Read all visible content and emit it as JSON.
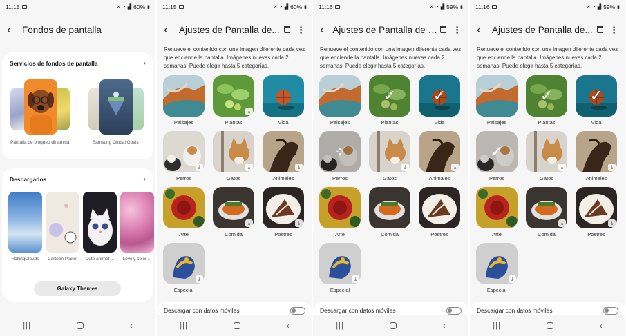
{
  "screen1": {
    "status": {
      "time": "11:15",
      "battery": "60%"
    },
    "header": {
      "title": "Fondos de pantalla"
    },
    "services": {
      "title": "Servicios de fondos de pantalla",
      "items": [
        {
          "label": "Pantalla de bloqueo dinámica"
        },
        {
          "label": "Samsung Global Goals"
        }
      ]
    },
    "downloaded": {
      "title": "Descargados",
      "items": [
        {
          "label": "RollingClouds"
        },
        {
          "label": "Cartoon Planet"
        },
        {
          "label": "Cute animal ..."
        },
        {
          "label": "Lovely color ..."
        }
      ]
    },
    "galaxy_themes": "Galaxy Themes"
  },
  "settings_screens": [
    {
      "status": {
        "time": "11:15",
        "battery": "60%"
      },
      "title": "Ajustes de Pantalla de...",
      "selected": [],
      "loading": [],
      "downloaded": [
        "Plantas",
        "Perros",
        "Gatos",
        "Animales",
        "Comida",
        "Postres",
        "Especial"
      ]
    },
    {
      "status": {
        "time": "11:16",
        "battery": "59%"
      },
      "title": "Ajustes de Pantalla de bloqueo",
      "selected": [
        "Plantas",
        "Vida"
      ],
      "loading": [
        "Perros"
      ],
      "downloaded": [
        "Gatos",
        "Animales",
        "Especial"
      ]
    },
    {
      "status": {
        "time": "11:16",
        "battery": "59%"
      },
      "title": "Ajustes de Pantalla de...",
      "selected": [
        "Plantas",
        "Vida",
        "Perros"
      ],
      "loading": [],
      "downloaded": [
        "Gatos",
        "Animales",
        "Comida",
        "Postres",
        "Especial"
      ]
    }
  ],
  "settings_common": {
    "description": "Renueve el contenido con una imagen diferente cada vez que enciende la pantalla. Imágenes nuevas cada 2 semanas. Puede elegir hasta 5 categorías.",
    "categories": [
      "Paisajes",
      "Plantas",
      "Vida",
      "Perros",
      "Gatos",
      "Animales",
      "Arte",
      "Comida",
      "Postres",
      "Especial"
    ],
    "mobile_data_label": "Descargar con datos móviles",
    "mobile_data_enabled": false
  },
  "colors": {
    "background": "#f6f6f6",
    "card": "#ffffff",
    "pill": "#e9e9e9"
  }
}
